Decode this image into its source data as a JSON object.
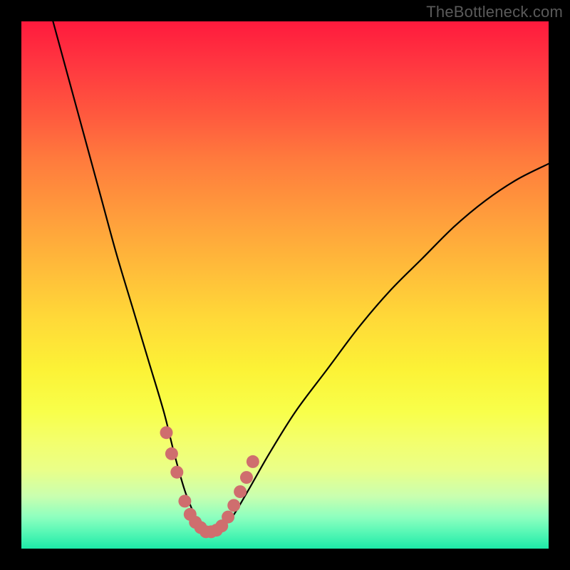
{
  "watermark": {
    "text": "TheBottleneck.com"
  },
  "chart_data": {
    "type": "line",
    "title": "",
    "xlabel": "",
    "ylabel": "",
    "xlim": [
      0,
      100
    ],
    "ylim": [
      0,
      100
    ],
    "series": [
      {
        "name": "bottleneck-curve",
        "x": [
          6,
          9,
          12,
          15,
          18,
          21,
          24,
          27,
          29,
          31,
          33,
          34,
          35,
          36,
          37,
          38,
          40,
          43,
          47,
          52,
          58,
          64,
          70,
          76,
          82,
          88,
          94,
          100
        ],
        "y": [
          100,
          89,
          78,
          67,
          56,
          46,
          36,
          26,
          18,
          11,
          6,
          4,
          3,
          3,
          3,
          4,
          6,
          11,
          18,
          26,
          34,
          42,
          49,
          55,
          61,
          66,
          70,
          73
        ]
      }
    ],
    "markers": {
      "name": "highlight-dots",
      "color": "#cf6e6e",
      "x": [
        27.5,
        28.5,
        29.5,
        31.0,
        32.0,
        33.0,
        34.0,
        35.0,
        36.0,
        37.0,
        38.0,
        39.2,
        40.3,
        41.5,
        42.7,
        43.9
      ],
      "y": [
        22.0,
        18.0,
        14.5,
        9.0,
        6.5,
        5.0,
        4.0,
        3.2,
        3.2,
        3.5,
        4.3,
        6.0,
        8.2,
        10.8,
        13.5,
        16.5
      ]
    },
    "background": {
      "type": "vertical-gradient",
      "stops": [
        {
          "pos": 0,
          "color": "#ff1a3d"
        },
        {
          "pos": 50,
          "color": "#ffc438"
        },
        {
          "pos": 75,
          "color": "#f8ff4a"
        },
        {
          "pos": 100,
          "color": "#1de9a8"
        }
      ]
    }
  }
}
